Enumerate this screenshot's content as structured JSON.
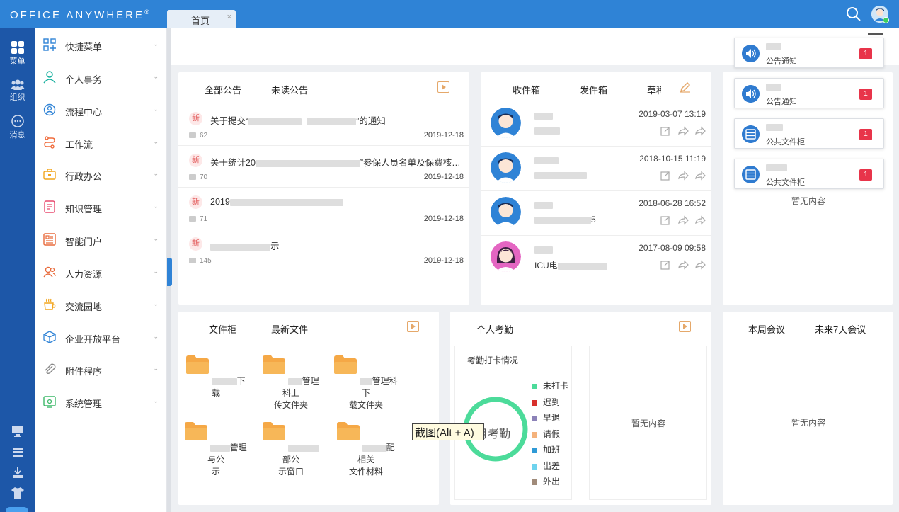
{
  "header": {
    "logo": "Office Anywhere",
    "logo_mark": "®",
    "tabs": [
      {
        "label": "首页",
        "close": "×"
      }
    ]
  },
  "rail": {
    "items": [
      {
        "label": "菜单",
        "icon": "grid-icon"
      },
      {
        "label": "组织",
        "icon": "people-icon"
      },
      {
        "label": "消息",
        "icon": "chat-icon"
      }
    ]
  },
  "menu": {
    "items": [
      {
        "label": "快捷菜单",
        "icon": "shortcut-icon",
        "color": "#2f83d6"
      },
      {
        "label": "个人事务",
        "icon": "person-icon",
        "color": "#1ab1a0"
      },
      {
        "label": "流程中心",
        "icon": "flow-center-icon",
        "color": "#2f83d6"
      },
      {
        "label": "工作流",
        "icon": "workflow-icon",
        "color": "#f06b3b"
      },
      {
        "label": "行政办公",
        "icon": "briefcase-icon",
        "color": "#f2a51d"
      },
      {
        "label": "知识管理",
        "icon": "book-icon",
        "color": "#e84a6f"
      },
      {
        "label": "智能门户",
        "icon": "portal-icon",
        "color": "#e86a3b"
      },
      {
        "label": "人力资源",
        "icon": "hr-icon",
        "color": "#e86a3b"
      },
      {
        "label": "交流园地",
        "icon": "cup-icon",
        "color": "#f2a51d"
      },
      {
        "label": "企业开放平台",
        "icon": "cube-icon",
        "color": "#2f83d6"
      },
      {
        "label": "附件程序",
        "icon": "paperclip-icon",
        "color": "#888888"
      },
      {
        "label": "系统管理",
        "icon": "settings-icon",
        "color": "#3cb868"
      }
    ]
  },
  "notices": {
    "tabs": [
      "全部公告",
      "未读公告"
    ],
    "new_label": "新",
    "items": [
      {
        "title_start": "关于提交“",
        "title_end": "”的通知",
        "comments": "62",
        "date": "2019-12-18"
      },
      {
        "title_start": "关于统计20",
        "title_end": "”参保人员名单及保费核…",
        "comments": "70",
        "date": "2019-12-18"
      },
      {
        "title_start": "2019",
        "title_end": "",
        "comments": "71",
        "date": "2019-12-18"
      },
      {
        "title_start": "",
        "title_end": "示",
        "comments": "145",
        "date": "2019-12-18"
      }
    ]
  },
  "mail": {
    "tabs": [
      "收件箱",
      "发件箱",
      "草稿"
    ],
    "items": [
      {
        "sender": "",
        "subject": "",
        "date": "2019-03-07 13:19",
        "avatar_color": "#2f83d6"
      },
      {
        "sender": "",
        "subject": "",
        "date": "2018-10-15 11:19",
        "avatar_color": "#2f83d6"
      },
      {
        "sender": "",
        "subject": "5",
        "date": "2018-06-28 16:52",
        "avatar_color": "#2f83d6"
      },
      {
        "sender": "",
        "subject": "ICU电",
        "date": "2017-08-09 09:58",
        "avatar_color": "#e466c2"
      }
    ]
  },
  "toasts": [
    {
      "type": "公告通知",
      "icon": "speaker-icon",
      "count": "1"
    },
    {
      "type": "公告通知",
      "icon": "speaker-icon",
      "count": "1"
    },
    {
      "type": "公共文件柜",
      "icon": "cabinet-icon",
      "count": "1"
    },
    {
      "type": "公共文件柜",
      "icon": "cabinet-icon",
      "count": "1"
    }
  ],
  "right_top": {
    "empty": "暂无内容"
  },
  "files": {
    "tabs": [
      "文件柜",
      "最新文件"
    ],
    "items": [
      {
        "line1": "下载",
        "line2": ""
      },
      {
        "line1": "管理科上",
        "line2": "传文件夹"
      },
      {
        "line1": "管理科下",
        "line2": "载文件夹"
      },
      {
        "line1": "管理与公",
        "line2": "示"
      },
      {
        "line1": "部公",
        "line2": "示窗口"
      },
      {
        "line1": "配相关",
        "line2": "文件材料"
      }
    ]
  },
  "attendance": {
    "title": "个人考勤",
    "subtitle": "考勤打卡情况",
    "center_text": "月考勤",
    "legend": [
      {
        "label": "未打卡",
        "color": "#4cdb9a"
      },
      {
        "label": "迟到",
        "color": "#d8302c"
      },
      {
        "label": "早退",
        "color": "#8c82b8"
      },
      {
        "label": "请假",
        "color": "#f4b27c"
      },
      {
        "label": "加班",
        "color": "#2f9ad6"
      },
      {
        "label": "出差",
        "color": "#6ed3ee"
      },
      {
        "label": "外出",
        "color": "#a08b7a"
      }
    ],
    "empty": "暂无内容"
  },
  "meetings": {
    "tabs": [
      "本周会议",
      "未来7天会议"
    ],
    "empty": "暂无内容"
  },
  "capture_tip": "截图(Alt + A)"
}
